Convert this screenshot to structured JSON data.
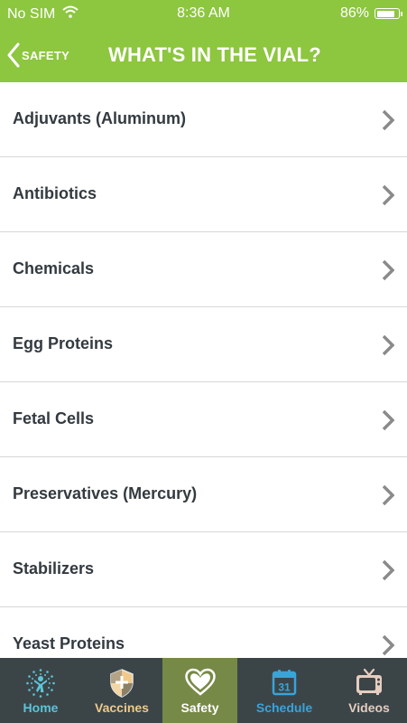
{
  "status_bar": {
    "carrier": "No SIM",
    "time": "8:36 AM",
    "battery_percent_label": "86%",
    "battery_level": 0.86,
    "wifi_icon": "wifi-icon"
  },
  "nav": {
    "back_label": "SAFETY",
    "title": "WHAT'S IN THE VIAL?",
    "background_color": "#8dc63f"
  },
  "list": {
    "items": [
      {
        "label": "Adjuvants (Aluminum)"
      },
      {
        "label": "Antibiotics"
      },
      {
        "label": "Chemicals"
      },
      {
        "label": "Egg Proteins"
      },
      {
        "label": "Fetal Cells"
      },
      {
        "label": "Preservatives (Mercury)"
      },
      {
        "label": "Stabilizers"
      },
      {
        "label": "Yeast Proteins"
      }
    ],
    "chevron_icon": "chevron-right-icon"
  },
  "tab_bar": {
    "active": "safety",
    "tabs": [
      {
        "id": "home",
        "label": "Home",
        "icon": "home-figure-icon",
        "color": "#5fc3d8"
      },
      {
        "id": "vaccines",
        "label": "Vaccines",
        "icon": "shield-icon",
        "color": "#f0c98a"
      },
      {
        "id": "safety",
        "label": "Safety",
        "icon": "heart-icon",
        "color": "#ffffff"
      },
      {
        "id": "schedule",
        "label": "Schedule",
        "icon": "calendar-icon",
        "color": "#3aa3d8",
        "calendar_day": "31"
      },
      {
        "id": "videos",
        "label": "Videos",
        "icon": "tv-icon",
        "color": "#e5cdbf"
      }
    ]
  }
}
